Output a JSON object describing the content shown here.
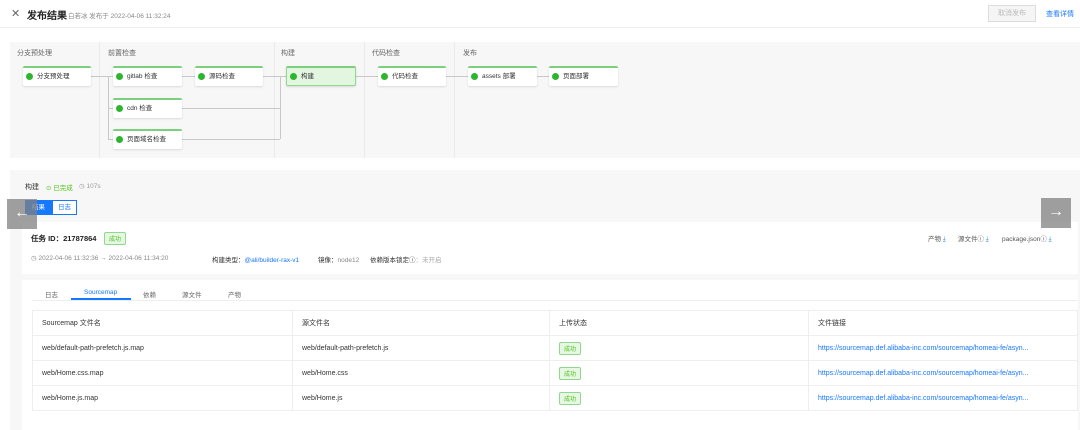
{
  "header": {
    "title": "发布结果",
    "subtitle": "白若冰 发布于 2022-04-06 11:32:24",
    "cancel": "取消发布",
    "detail": "查看详情"
  },
  "pipeline": {
    "stages": [
      "分支预处理",
      "前置检查",
      "构建",
      "代码检查",
      "发布"
    ],
    "nodes": {
      "branch": "分支预处理",
      "gitlab": "gitlab 检查",
      "source": "源码检查",
      "cdn": "cdn 检查",
      "domain": "页面域名检查",
      "build": "构建",
      "code": "代码检查",
      "assets": "assets 部署",
      "page": "页面部署"
    }
  },
  "build": {
    "title": "构建",
    "status": "已完成",
    "duration": "107s",
    "tab_result": "结果",
    "tab_log": "日志"
  },
  "task": {
    "id_label": "任务 ID：",
    "id": "21787864",
    "status": "成功",
    "time": "2022-04-06 11:32:36 → 2022-04-06 11:34:20",
    "type_label": "构建类型：",
    "type": "@ali/builder-rax-v1",
    "image_label": "镜像：",
    "image": "node12",
    "lock_label": "依赖版本锁定",
    "lock": "：未开启",
    "dl": [
      "产物",
      "源文件",
      "package.json"
    ]
  },
  "tabs": [
    "日志",
    "Sourcemap",
    "依赖",
    "源文件",
    "产物"
  ],
  "table": {
    "headers": [
      "Sourcemap 文件名",
      "源文件名",
      "上传状态",
      "文件链接"
    ],
    "rows": [
      [
        "web/default-path-prefetch.js.map",
        "web/default-path-prefetch.js",
        "成功",
        "https://sourcemap.def.alibaba-inc.com/sourcemap/homeai-fe/asyn..."
      ],
      [
        "web/Home.css.map",
        "web/Home.css",
        "成功",
        "https://sourcemap.def.alibaba-inc.com/sourcemap/homeai-fe/asyn..."
      ],
      [
        "web/Home.js.map",
        "web/Home.js",
        "成功",
        "https://sourcemap.def.alibaba-inc.com/sourcemap/homeai-fe/asyn..."
      ]
    ]
  }
}
